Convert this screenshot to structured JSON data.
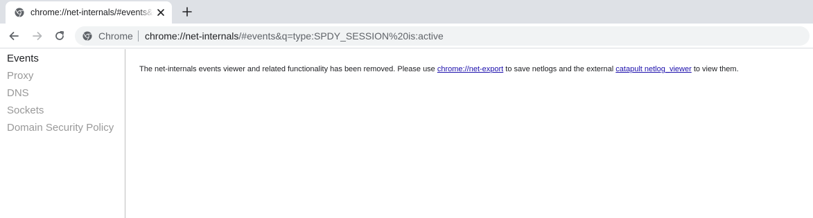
{
  "tab": {
    "title": "chrome://net-internals/#events&q=type:SPDY_SESSION%20is:active",
    "favicon": "chrome-logo-icon",
    "close_icon": "close-icon",
    "new_tab_icon": "plus-icon"
  },
  "toolbar": {
    "back_icon": "arrow-left-icon",
    "forward_icon": "arrow-right-icon",
    "reload_icon": "reload-icon",
    "site_icon": "chrome-logo-icon",
    "chip_label": "Chrome",
    "url_host": "chrome://net-internals",
    "url_rest": "/#events&q=type:SPDY_SESSION%20is:active"
  },
  "sidebar": {
    "items": [
      {
        "label": "Events",
        "active": true
      },
      {
        "label": "Proxy",
        "active": false
      },
      {
        "label": "DNS",
        "active": false
      },
      {
        "label": "Sockets",
        "active": false
      },
      {
        "label": "Domain Security Policy",
        "active": false
      }
    ]
  },
  "content": {
    "text_1": "The net-internals events viewer and related functionality has been removed. Please use ",
    "link_1": "chrome://net-export",
    "text_2": " to save netlogs and the external ",
    "link_2": "catapult netlog_viewer",
    "text_3": " to view them."
  },
  "colors": {
    "tabstrip_bg": "#dee1e6",
    "omnibox_bg": "#f1f3f4",
    "link": "#1a0dab",
    "inactive_nav": "#999999"
  }
}
